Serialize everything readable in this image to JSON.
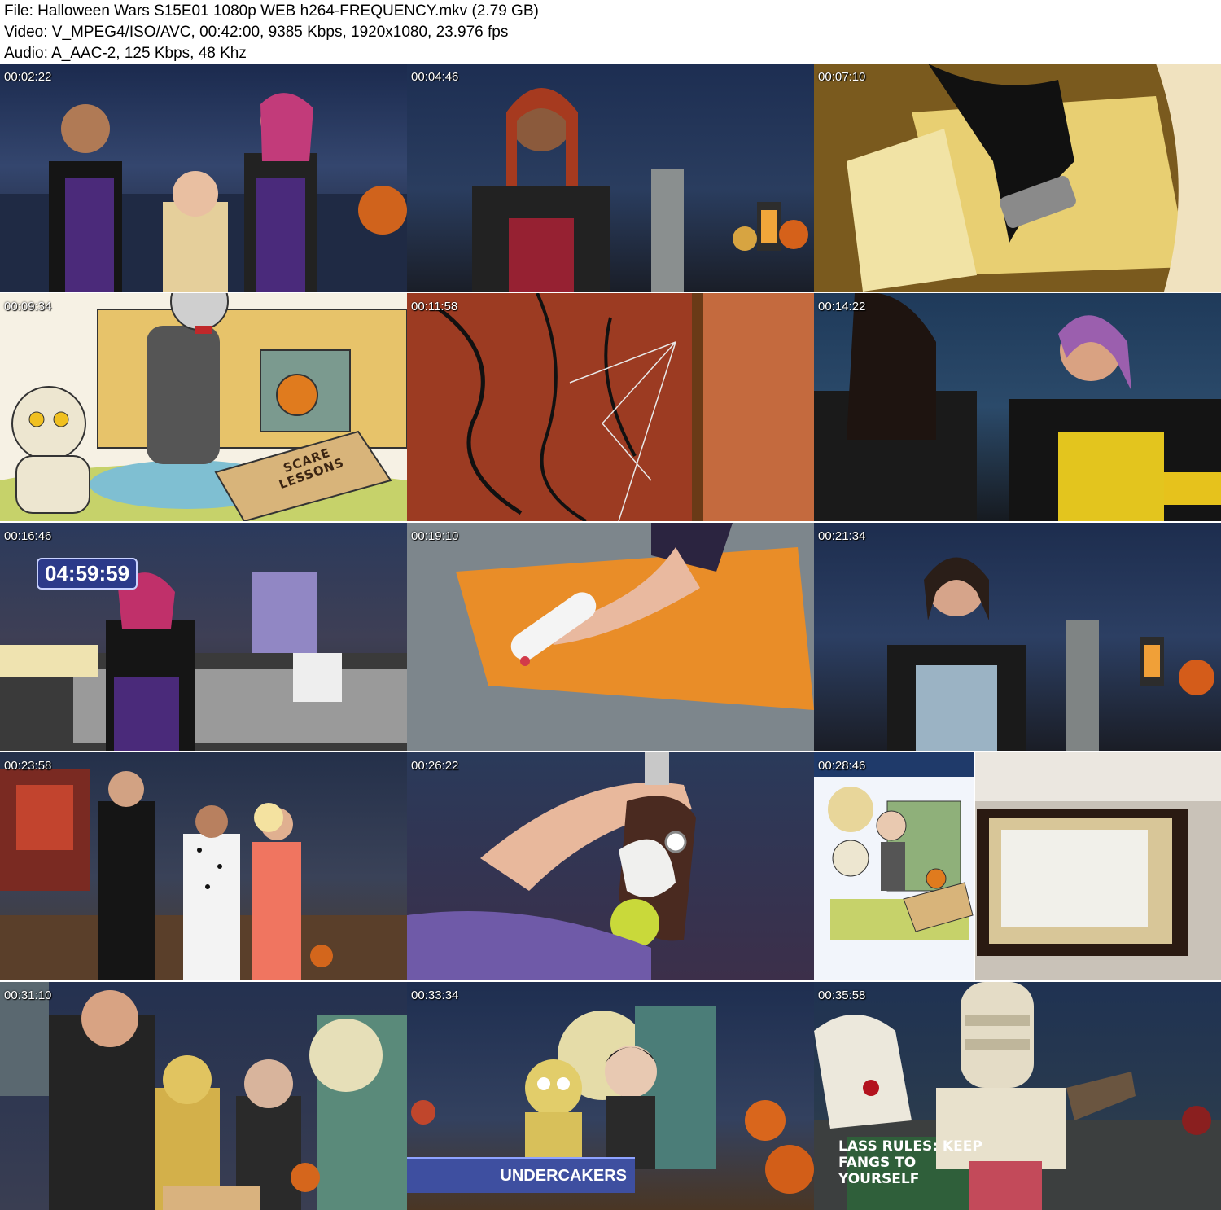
{
  "header": {
    "file_line": "File: Halloween Wars S15E01 1080p WEB h264-FREQUENCY.mkv (2.79 GB)",
    "video_line": "Video: V_MPEG4/ISO/AVC, 00:42:00, 9385 Kbps, 1920x1080, 23.976 fps",
    "audio_line": "Audio: A_AAC-2, 125 Kbps, 48 Khz"
  },
  "thumbnails": [
    {
      "timestamp": "00:02:22",
      "scene": "three-contestants-purple-aprons"
    },
    {
      "timestamp": "00:04:46",
      "scene": "contestant-red-apron-interview"
    },
    {
      "timestamp": "00:07:10",
      "scene": "gloved-hands-cutting-yellow"
    },
    {
      "timestamp": "00:09:34",
      "scene": "sketch-mummy-vampire"
    },
    {
      "timestamp": "00:11:58",
      "scene": "cracked-glass-orange-wall"
    },
    {
      "timestamp": "00:14:22",
      "scene": "two-contestants-yellow-aprons"
    },
    {
      "timestamp": "00:16:46",
      "scene": "kitchen-work-with-timer"
    },
    {
      "timestamp": "00:19:10",
      "scene": "rolling-orange-fondant"
    },
    {
      "timestamp": "00:21:34",
      "scene": "contestant-blue-apron-interview"
    },
    {
      "timestamp": "00:23:58",
      "scene": "hosts-and-judges"
    },
    {
      "timestamp": "00:26:22",
      "scene": "hands-shaping-piece"
    },
    {
      "timestamp": "00:28:46",
      "scene": "sketch-and-cake-cross-section"
    },
    {
      "timestamp": "00:31:10",
      "scene": "team-decorating-display"
    },
    {
      "timestamp": "00:33:34",
      "scene": "finished-display-team-banner"
    },
    {
      "timestamp": "00:35:58",
      "scene": "mummy-figure-closeup"
    }
  ],
  "overlays": {
    "timer": "04:59:59",
    "team_name": "UNDERCAKERS",
    "book_title": "SCARE LESSONS",
    "sign_text": "LASS RULES: KEEP FANGS TO YOURSELF"
  },
  "colors": {
    "background": "#ffffff",
    "timer_bg": "#2c3a8a",
    "banner_bg": "#3e4fa0"
  }
}
